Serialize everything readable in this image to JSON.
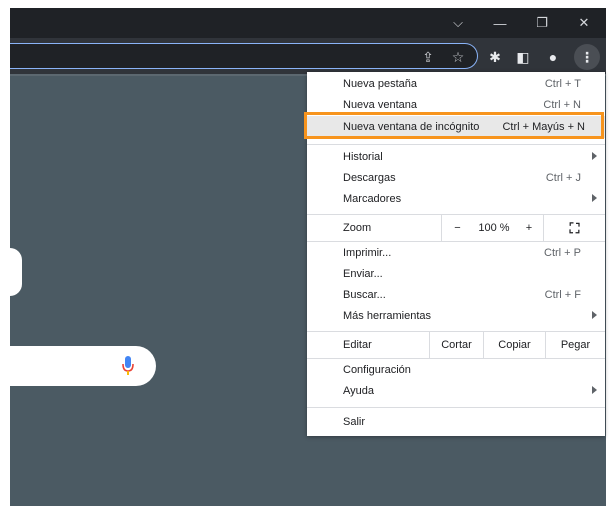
{
  "window": {
    "chevron_glyph": "⌵",
    "minimize_glyph": "—",
    "restore_glyph": "❐",
    "close_glyph": "✕"
  },
  "toolbar": {
    "share_glyph": "⇪",
    "star_glyph": "☆",
    "extensions_glyph": "✱",
    "sidepanel_glyph": "◧",
    "profile_glyph": "●",
    "menu_glyph": "⋮"
  },
  "menu": {
    "new_tab": {
      "label": "Nueva pestaña",
      "shortcut": "Ctrl + T"
    },
    "new_window": {
      "label": "Nueva ventana",
      "shortcut": "Ctrl + N"
    },
    "incognito": {
      "label": "Nueva ventana de incógnito",
      "shortcut": "Ctrl + Mayús + N"
    },
    "history": {
      "label": "Historial"
    },
    "downloads": {
      "label": "Descargas",
      "shortcut": "Ctrl + J"
    },
    "bookmarks": {
      "label": "Marcadores"
    },
    "zoom": {
      "label": "Zoom",
      "minus": "−",
      "value": "100 %",
      "plus": "+",
      "fullscreen": "⛶"
    },
    "print": {
      "label": "Imprimir...",
      "shortcut": "Ctrl + P"
    },
    "send": {
      "label": "Enviar..."
    },
    "find": {
      "label": "Buscar...",
      "shortcut": "Ctrl + F"
    },
    "more_tools": {
      "label": "Más herramientas"
    },
    "edit": {
      "label": "Editar",
      "cut": "Cortar",
      "copy": "Copiar",
      "paste": "Pegar"
    },
    "settings": {
      "label": "Configuración"
    },
    "help": {
      "label": "Ayuda"
    },
    "exit": {
      "label": "Salir"
    }
  },
  "colors": {
    "page_bg": "#4b5a63",
    "titlebar": "#1f2226",
    "toolbar": "#30343a",
    "highlight": "#f7941d",
    "omnibox_border": "#8ab4f8"
  }
}
